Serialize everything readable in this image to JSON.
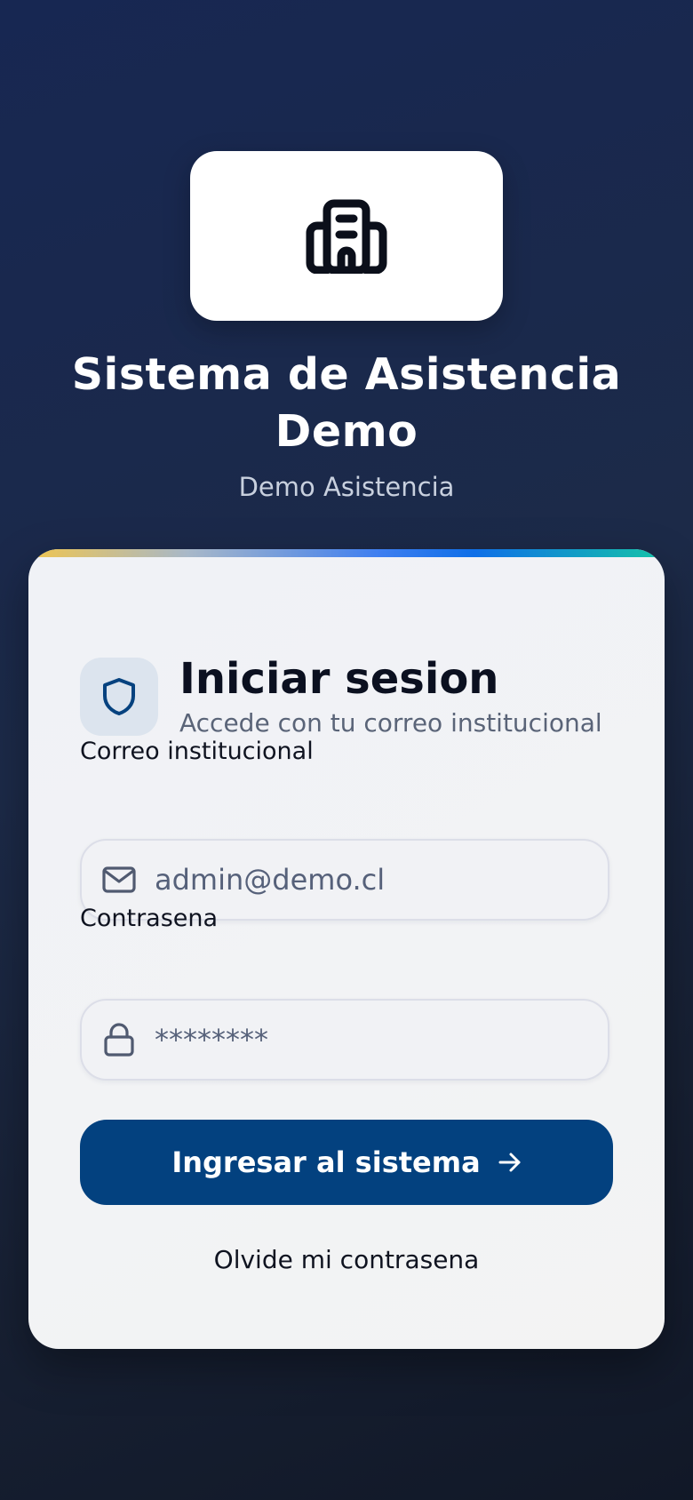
{
  "header": {
    "logo_icon": "building-icon",
    "title": "Sistema de Asistencia Demo",
    "subtitle": "Demo Asistencia"
  },
  "login_card": {
    "shield_icon": "shield-icon",
    "title": "Iniciar sesion",
    "subtitle": "Accede con tu correo institucional",
    "email": {
      "label": "Correo institucional",
      "value": "admin@demo.cl",
      "icon": "mail-icon"
    },
    "password": {
      "label": "Contrasena",
      "value": "********",
      "icon": "lock-icon"
    },
    "submit_label": "Ingresar al sistema",
    "submit_icon": "arrow-right-icon",
    "forgot_label": "Olvide mi contrasena"
  },
  "colors": {
    "primary": "#03417f",
    "background": "#1c2a48",
    "card": "#f2f3f5"
  }
}
